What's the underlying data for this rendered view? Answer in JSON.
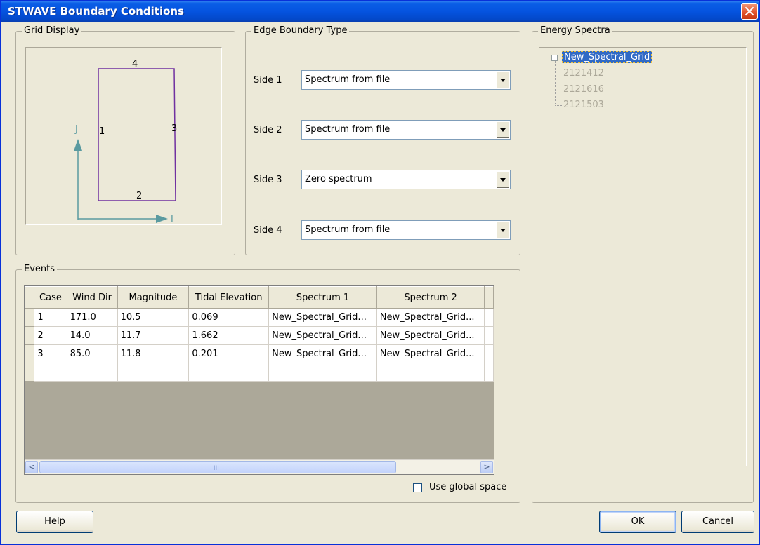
{
  "window": {
    "title": "STWAVE Boundary Conditions"
  },
  "grid_display": {
    "label": "Grid Display",
    "side_labels": [
      "4",
      "1",
      "3",
      "2"
    ],
    "axis_j": "J",
    "axis_i": "I",
    "colors": {
      "outline": "#7030a0",
      "axis": "#5a9aa0"
    }
  },
  "edge_boundary": {
    "label": "Edge Boundary Type",
    "sides": [
      {
        "label": "Side 1",
        "value": "Spectrum from file"
      },
      {
        "label": "Side 2",
        "value": "Spectrum from file"
      },
      {
        "label": "Side 3",
        "value": "Zero spectrum"
      },
      {
        "label": "Side 4",
        "value": "Spectrum from file"
      }
    ]
  },
  "energy_spectra": {
    "label": "Energy Spectra",
    "root": "New_Spectral_Grid",
    "children": [
      "2121412",
      "2121616",
      "2121503"
    ]
  },
  "events": {
    "label": "Events",
    "columns": [
      "Case",
      "Wind Dir",
      "Magnitude",
      "Tidal Elevation",
      "Spectrum 1",
      "Spectrum 2"
    ],
    "rows": [
      [
        "1",
        "171.0",
        "10.5",
        "0.069",
        "New_Spectral_Grid...",
        "New_Spectral_Grid..."
      ],
      [
        "2",
        "14.0",
        "11.7",
        "1.662",
        "New_Spectral_Grid...",
        "New_Spectral_Grid..."
      ],
      [
        "3",
        "85.0",
        "11.8",
        "0.201",
        "New_Spectral_Grid...",
        "New_Spectral_Grid..."
      ],
      [
        "",
        "",
        "",
        "",
        "",
        ""
      ]
    ],
    "scroll_left": "<",
    "scroll_right": ">",
    "scroll_grip": "III",
    "use_global_space": {
      "label": "Use global space",
      "checked": false
    }
  },
  "buttons": {
    "help": "Help",
    "ok": "OK",
    "cancel": "Cancel"
  }
}
